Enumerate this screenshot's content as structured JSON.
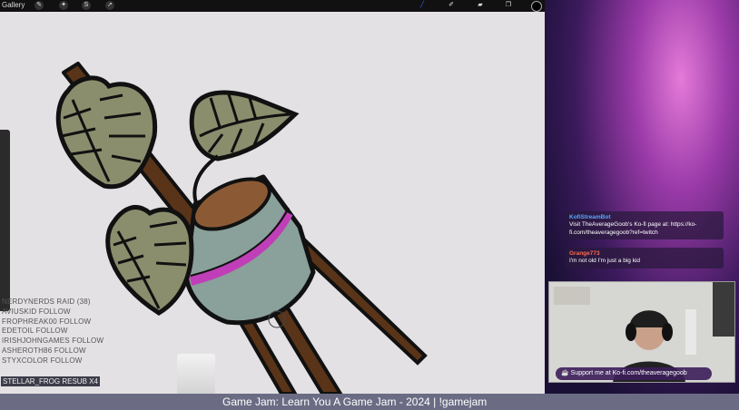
{
  "topbar": {
    "gallery_label": "Gallery",
    "tools": [
      "wrench-icon",
      "magic-wand-icon",
      "selection-icon",
      "transform-arrow-icon"
    ],
    "right_tools": [
      "brush-icon",
      "smudge-icon",
      "eraser-icon",
      "layers-icon",
      "color-swatch"
    ],
    "accent_color": "#2f6df2"
  },
  "event_feed": [
    {
      "text": "NERDYNERDS  RAID (38)"
    },
    {
      "text": "AVIUSKID  FOLLOW"
    },
    {
      "text": "FROPHREAK00  FOLLOW"
    },
    {
      "text": "EDETOIL  FOLLOW"
    },
    {
      "text": "IRISHJOHNGAMES  FOLLOW"
    },
    {
      "text": "ASHEROTH86  FOLLOW"
    },
    {
      "text": "STYXCOLOR  FOLLOW"
    }
  ],
  "resub_badge": "STELLAR_FROG  RESUB X4",
  "chat": [
    {
      "user": "KofiStreamBot",
      "message": "Visit TheAverageGoob's Ko-fi page at: https://ko-fi.com/theaveragegoob?ref=twitch"
    },
    {
      "user": "Grange773",
      "message": "I'm not old I'm just a big kid"
    }
  ],
  "kofi_bar": "Support me at Ko-fi.com/theaveragegoob",
  "banner": "Game Jam: Learn You A Game Jam - 2024 | !gamejam",
  "colors": {
    "leaf": "#8a8e6d",
    "pot": "#8aa09a",
    "stripe": "#c03fb8",
    "stick": "#5a3418"
  }
}
